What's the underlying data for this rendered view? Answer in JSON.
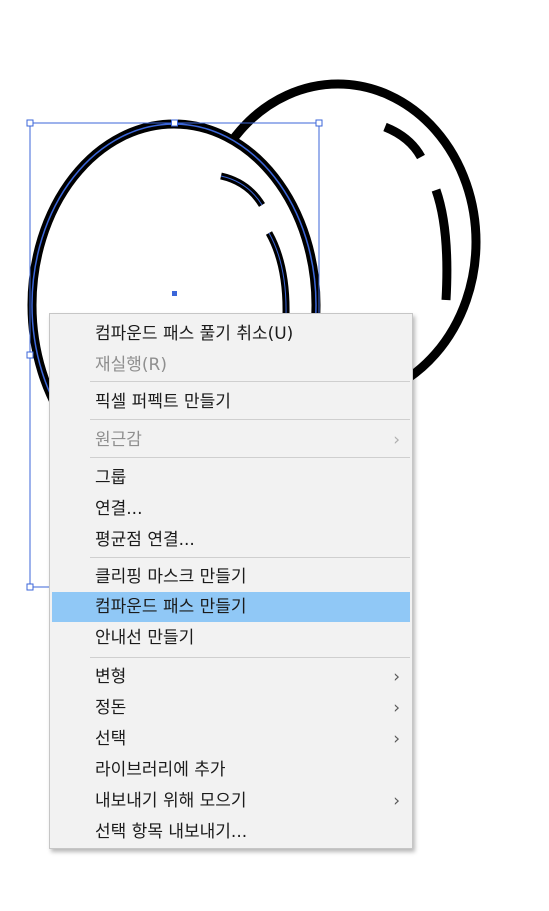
{
  "canvas": {
    "selection_color": "#3b66d9",
    "stroke_color": "#000000"
  },
  "context_menu": {
    "highlight_color": "#90c8f6",
    "items": [
      {
        "label": "컴파운드 패스 풀기 취소(U)",
        "enabled": true
      },
      {
        "label": "재실행(R)",
        "enabled": false
      },
      {
        "label": "픽셀 퍼펙트 만들기",
        "enabled": true
      },
      {
        "label": "원근감",
        "enabled": false,
        "submenu": true
      },
      {
        "label": "그룹",
        "enabled": true
      },
      {
        "label": "연결...",
        "enabled": true
      },
      {
        "label": "평균점 연결...",
        "enabled": true
      },
      {
        "label": "클리핑 마스크 만들기",
        "enabled": true
      },
      {
        "label": "컴파운드 패스 만들기",
        "enabled": true,
        "highlighted": true
      },
      {
        "label": "안내선 만들기",
        "enabled": true
      },
      {
        "label": "변형",
        "enabled": true,
        "submenu": true
      },
      {
        "label": "정돈",
        "enabled": true,
        "submenu": true
      },
      {
        "label": "선택",
        "enabled": true,
        "submenu": true
      },
      {
        "label": "라이브러리에 추가",
        "enabled": true
      },
      {
        "label": "내보내기 위해 모으기",
        "enabled": true,
        "submenu": true
      },
      {
        "label": "선택 항목 내보내기...",
        "enabled": true
      }
    ],
    "submenu_glyph": "›"
  }
}
